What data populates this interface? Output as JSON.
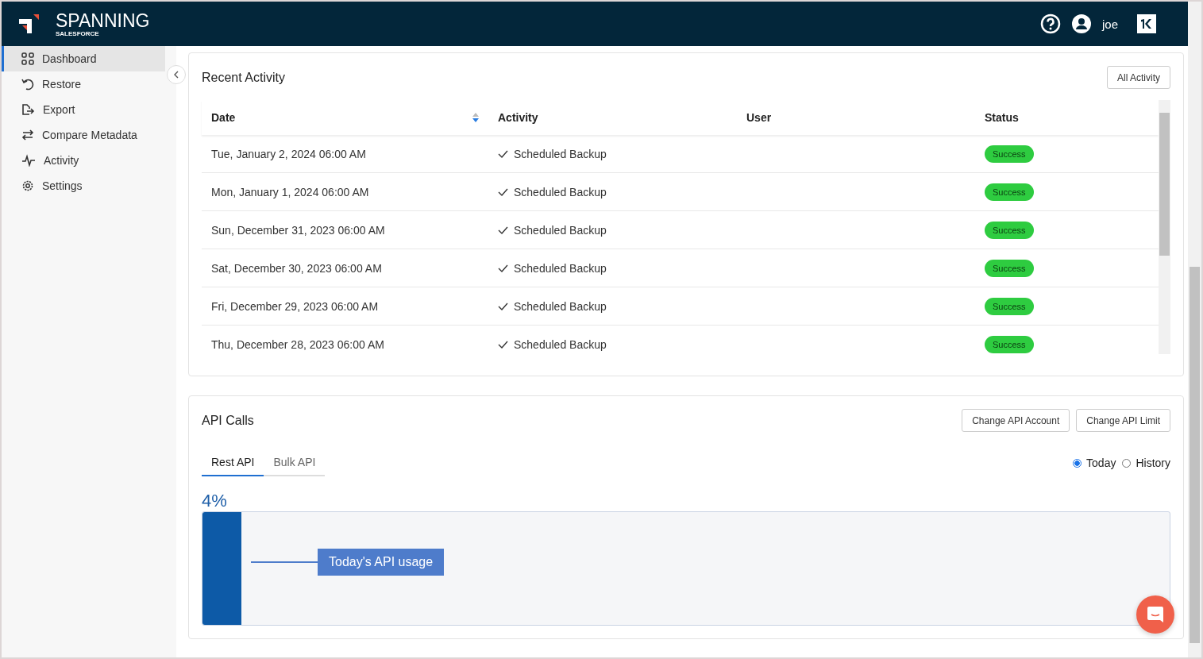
{
  "header": {
    "logo": "SPANNING",
    "logo_sub": "SALESFORCE",
    "user": "joe"
  },
  "sidebar": {
    "items": [
      {
        "label": "Dashboard",
        "kind": "grid",
        "selected": true
      },
      {
        "label": "Restore",
        "kind": "restore",
        "selected": false
      },
      {
        "label": "Export",
        "kind": "export",
        "selected": false
      },
      {
        "label": "Compare Metadata",
        "kind": "compare",
        "selected": false
      },
      {
        "label": "Activity",
        "kind": "pulse",
        "selected": false
      },
      {
        "label": "Settings",
        "kind": "gear",
        "selected": false
      }
    ]
  },
  "recent_activity": {
    "title": "Recent Activity",
    "button": "All Activity",
    "columns": [
      "Date",
      "Activity",
      "User",
      "Status"
    ],
    "rows": [
      {
        "date": "Tue, January 2, 2024 06:00 AM",
        "activity": "Scheduled Backup",
        "user": "",
        "status": "Success"
      },
      {
        "date": "Mon, January 1, 2024 06:00 AM",
        "activity": "Scheduled Backup",
        "user": "",
        "status": "Success"
      },
      {
        "date": "Sun, December 31, 2023 06:00 AM",
        "activity": "Scheduled Backup",
        "user": "",
        "status": "Success"
      },
      {
        "date": "Sat, December 30, 2023 06:00 AM",
        "activity": "Scheduled Backup",
        "user": "",
        "status": "Success"
      },
      {
        "date": "Fri, December 29, 2023 06:00 AM",
        "activity": "Scheduled Backup",
        "user": "",
        "status": "Success"
      },
      {
        "date": "Thu, December 28, 2023 06:00 AM",
        "activity": "Scheduled Backup",
        "user": "",
        "status": "Success"
      }
    ]
  },
  "api_calls": {
    "title": "API Calls",
    "buttons": [
      "Change API Account",
      "Change API Limit"
    ],
    "tabs": [
      {
        "label": "Rest API",
        "selected": true
      },
      {
        "label": "Bulk API",
        "selected": false
      }
    ],
    "range": [
      {
        "label": "Today",
        "selected": true
      },
      {
        "label": "History",
        "selected": false
      }
    ],
    "percent": "4%",
    "usage": {
      "level": 0.04,
      "label": "Today's API usage"
    }
  }
}
